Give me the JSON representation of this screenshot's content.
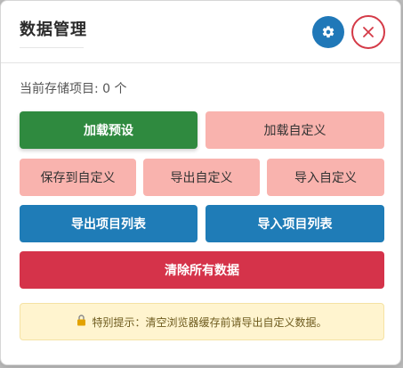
{
  "modal": {
    "title": "数据管理",
    "storage_count": "当前存储项目: 0 个"
  },
  "buttons": {
    "load_preset": "加载预设",
    "load_custom": "加载自定义",
    "save_custom": "保存到自定义",
    "export_custom": "导出自定义",
    "import_custom": "导入自定义",
    "export_list": "导出项目列表",
    "import_list": "导入项目列表",
    "clear_all": "清除所有数据"
  },
  "notice": {
    "text": "特别提示：清空浏览器缓存前请导出自定义数据。"
  },
  "icons": {
    "settings": "gear-icon",
    "close": "close-icon",
    "notice": "lock-icon"
  },
  "colors": {
    "primary_green": "#2f8a3f",
    "light_pink": "#f9b3ae",
    "blue": "#1f7cb7",
    "red": "#d5334a",
    "notice_bg": "#fff4cf"
  }
}
